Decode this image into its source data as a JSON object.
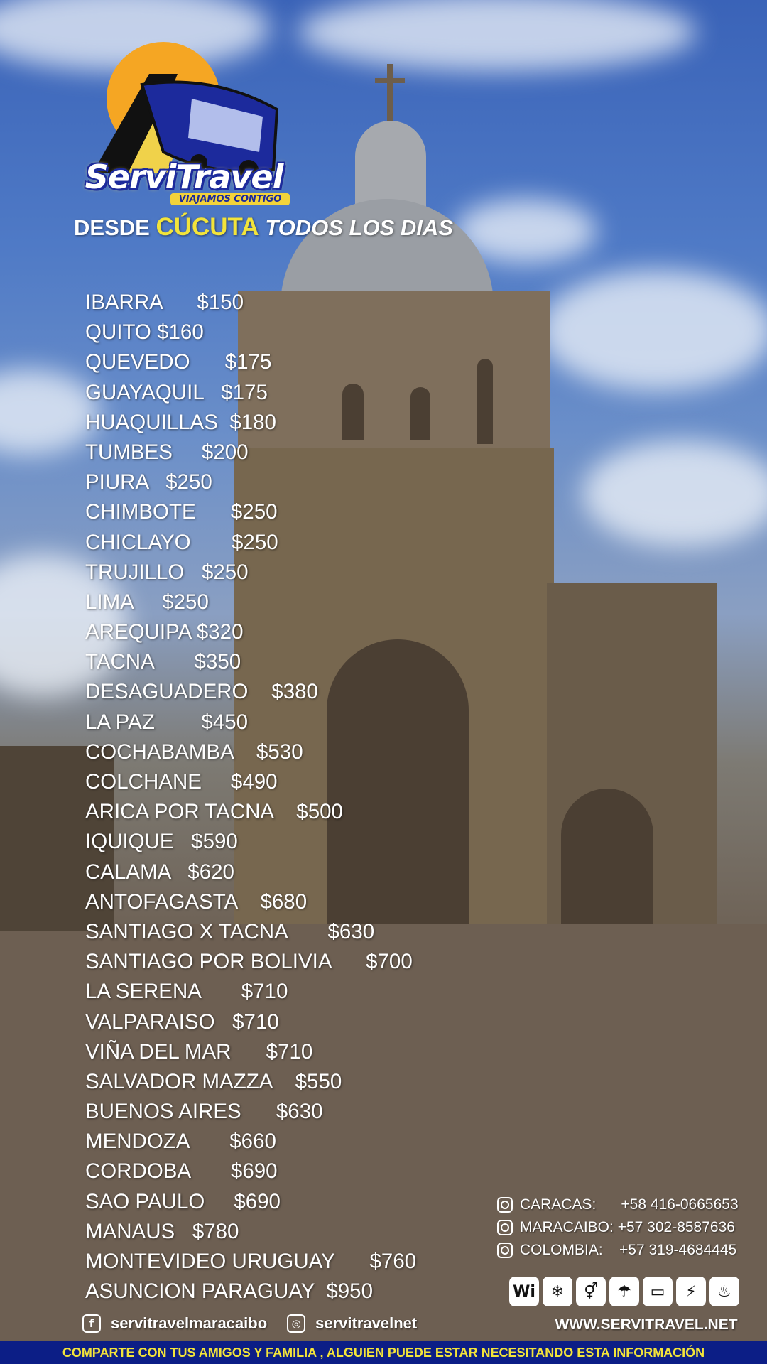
{
  "brand": {
    "name": "ServiTravel",
    "tagline": "VIAJAMOS CONTIGO",
    "colors": {
      "primary_blue": "#1c2a9c",
      "accent_yellow": "#f3e43a",
      "logo_orange": "#f5a623"
    }
  },
  "headline": {
    "prefix": "DESDE",
    "city": "CÚCUTA",
    "suffix": "TODOS LOS DIAS"
  },
  "routes": [
    {
      "name": "IBARRA",
      "gap": "      ",
      "price": "$150"
    },
    {
      "name": "QUITO",
      "gap": " ",
      "price": "$160"
    },
    {
      "name": "QUEVEDO",
      "gap": "      ",
      "price": "$175"
    },
    {
      "name": "GUAYAQUIL",
      "gap": "   ",
      "price": "$175"
    },
    {
      "name": "HUAQUILLAS",
      "gap": "  ",
      "price": "$180"
    },
    {
      "name": "TUMBES",
      "gap": "     ",
      "price": "$200"
    },
    {
      "name": "PIURA",
      "gap": "   ",
      "price": "$250"
    },
    {
      "name": "CHIMBOTE",
      "gap": "      ",
      "price": "$250"
    },
    {
      "name": "CHICLAYO",
      "gap": "       ",
      "price": "$250"
    },
    {
      "name": "TRUJILLO",
      "gap": "   ",
      "price": "$250"
    },
    {
      "name": "LIMA",
      "gap": "     ",
      "price": "$250"
    },
    {
      "name": "AREQUIPA",
      "gap": " ",
      "price": "$320"
    },
    {
      "name": "TACNA",
      "gap": "       ",
      "price": "$350"
    },
    {
      "name": "DESAGUADERO",
      "gap": "    ",
      "price": "$380"
    },
    {
      "name": "LA PAZ",
      "gap": "        ",
      "price": "$450"
    },
    {
      "name": "COCHABAMBA",
      "gap": "    ",
      "price": "$530"
    },
    {
      "name": "COLCHANE",
      "gap": "     ",
      "price": "$490"
    },
    {
      "name": "ARICA POR TACNA",
      "gap": "    ",
      "price": "$500"
    },
    {
      "name": "IQUIQUE",
      "gap": "   ",
      "price": "$590"
    },
    {
      "name": "CALAMA",
      "gap": "   ",
      "price": "$620"
    },
    {
      "name": "ANTOFAGASTA",
      "gap": "    ",
      "price": "$680"
    },
    {
      "name": "SANTIAGO X TACNA",
      "gap": "       ",
      "price": "$630"
    },
    {
      "name": "SANTIAGO POR BOLIVIA",
      "gap": "      ",
      "price": "$700"
    },
    {
      "name": "LA SERENA",
      "gap": "       ",
      "price": "$710"
    },
    {
      "name": "VALPARAISO",
      "gap": "   ",
      "price": "$710"
    },
    {
      "name": "VIÑA DEL MAR",
      "gap": "      ",
      "price": "$710"
    },
    {
      "name": "SALVADOR MAZZA",
      "gap": "    ",
      "price": "$550"
    },
    {
      "name": "BUENOS AIRES",
      "gap": "      ",
      "price": "$630"
    },
    {
      "name": "MENDOZA",
      "gap": "       ",
      "price": "$660"
    },
    {
      "name": "CORDOBA",
      "gap": "       ",
      "price": "$690"
    },
    {
      "name": "SAO PAULO",
      "gap": "     ",
      "price": "$690"
    },
    {
      "name": "MANAUS",
      "gap": "   ",
      "price": "$780"
    },
    {
      "name": "MONTEVIDEO URUGUAY",
      "gap": "      ",
      "price": "$760"
    },
    {
      "name": "ASUNCION PARAGUAY",
      "gap": "  ",
      "price": "$950"
    }
  ],
  "contacts": [
    {
      "label": "CARACAS:",
      "gap": "      ",
      "phone": "+58 416-0665653",
      "icon": "whatsapp-icon"
    },
    {
      "label": "MARACAIBO:",
      "gap": " ",
      "phone": "+57 302-8587636",
      "icon": "whatsapp-icon"
    },
    {
      "label": "COLOMBIA:",
      "gap": "    ",
      "phone": "+57 319-4684445",
      "icon": "whatsapp-icon"
    }
  ],
  "amenities": [
    {
      "name": "wifi-icon",
      "glyph": "Wi"
    },
    {
      "name": "air-conditioning-icon",
      "glyph": "❄"
    },
    {
      "name": "restroom-icon",
      "glyph": "⚥"
    },
    {
      "name": "shower-icon",
      "glyph": "☂"
    },
    {
      "name": "tv-icon",
      "glyph": "▭"
    },
    {
      "name": "power-outlet-icon",
      "glyph": "⚡"
    },
    {
      "name": "dining-icon",
      "glyph": "♨"
    }
  ],
  "social": {
    "facebook": {
      "icon": "facebook-icon",
      "glyph": "f",
      "handle": "servitravelmaracaibo"
    },
    "instagram": {
      "icon": "instagram-icon",
      "glyph": "◎",
      "handle": "servitravelnet"
    }
  },
  "website": "WWW.SERVITRAVEL.NET",
  "footer": "COMPARTE CON TUS AMIGOS Y FAMILIA , ALGUIEN PUEDE ESTAR NECESITANDO ESTA INFORMACIÓN"
}
